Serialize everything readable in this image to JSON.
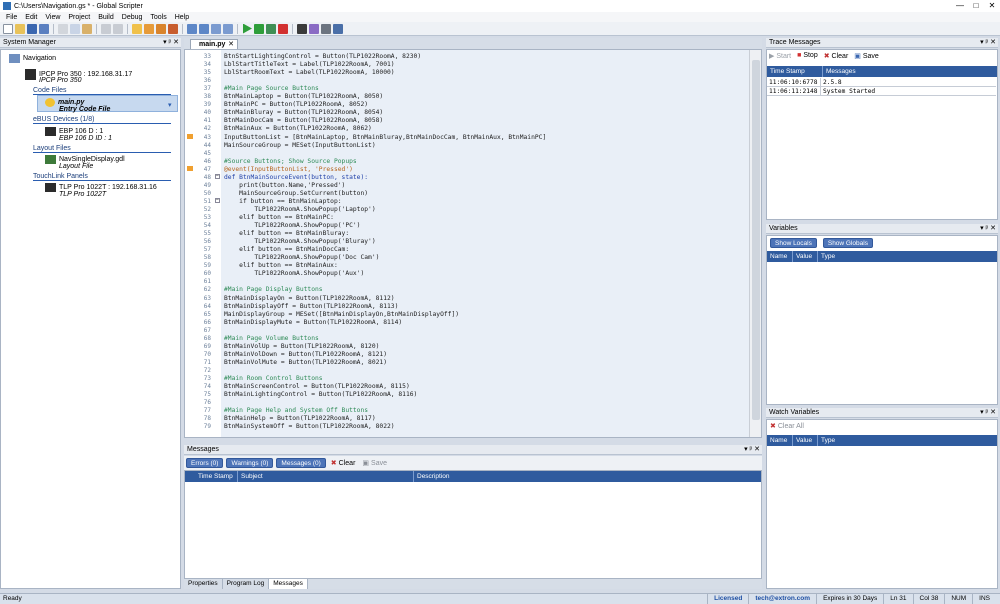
{
  "window": {
    "title": "C:\\Users\\Navigation.gs * - Global Scripter",
    "controls": [
      "—",
      "□",
      "✕"
    ]
  },
  "menu": [
    "File",
    "Edit",
    "View",
    "Project",
    "Build",
    "Debug",
    "Tools",
    "Help"
  ],
  "toolbar_icons": [
    "new-icon",
    "open-icon",
    "save-icon",
    "save-all-icon",
    "cut-icon",
    "copy-icon",
    "paste-icon",
    "undo-icon",
    "redo-icon",
    "add-file-icon",
    "add-device-icon",
    "add-panel-icon",
    "settings-icon",
    "indent-icon",
    "unindent-icon",
    "comment-icon",
    "uncomment-icon",
    "run-icon",
    "debug-icon",
    "step-icon",
    "stop-icon",
    "pilcrow-icon",
    "wand-icon",
    "pin-icon",
    "tool-icon"
  ],
  "system_manager": {
    "title": "System Manager",
    "root": "Navigation",
    "controller": {
      "name": "IPCP Pro 350 : 192.168.31.17",
      "sub": "IPCP Pro 350"
    },
    "code_files": {
      "header": "Code Files",
      "file": "main.py",
      "sub": "Entry Code File"
    },
    "ebus": {
      "header": "eBUS Devices (1/8)",
      "name": "EBP 106 D : 1",
      "sub": "EBP 106 D ID : 1"
    },
    "layout": {
      "header": "Layout Files",
      "name": "NavSingleDisplay.gdl",
      "sub": "Layout File"
    },
    "touchlink": {
      "header": "TouchLink Panels",
      "name": "TLP Pro 1022T : 192.168.31.16",
      "sub": "TLP Pro 1022T"
    }
  },
  "editor": {
    "tab": "main.py",
    "lines": [
      {
        "n": "33",
        "t": "BtnStartLightingControl = Button(TLP1022RoomA, 8230)"
      },
      {
        "n": "34",
        "t": "LblStartTitleText = Label(TLP1022RoomA, 7001)"
      },
      {
        "n": "35",
        "t": "LblStartRoomText = Label(TLP1022RoomA, 10000)"
      },
      {
        "n": "36",
        "t": ""
      },
      {
        "n": "37",
        "t": "#Main Page Source Buttons"
      },
      {
        "n": "38",
        "t": "BtnMainLaptop = Button(TLP1022RoomA, 8050)"
      },
      {
        "n": "39",
        "t": "BtnMainPC = Button(TLP1022RoomA, 8052)"
      },
      {
        "n": "40",
        "t": "BtnMainBluray = Button(TLP1022RoomA, 8054)"
      },
      {
        "n": "41",
        "t": "BtnMainDocCam = Button(TLP1022RoomA, 8058)"
      },
      {
        "n": "42",
        "t": "BtnMainAux = Button(TLP1022RoomA, 8062)"
      },
      {
        "n": "43",
        "t": "InputButtonList = [BtnMainLaptop, BtnMainBluray,BtnMainDocCam, BtnMainAux, BtnMainPC]"
      },
      {
        "n": "44",
        "t": "MainSourceGroup = MESet(InputButtonList)"
      },
      {
        "n": "45",
        "t": ""
      },
      {
        "n": "46",
        "t": "#Source Buttons; Show Source Popups"
      },
      {
        "n": "47",
        "t": "@event(InputButtonList, 'Pressed')"
      },
      {
        "n": "48",
        "t": "def BtnMainSourceEvent(button, state):"
      },
      {
        "n": "49",
        "t": "    print(button.Name,'Pressed')"
      },
      {
        "n": "50",
        "t": "    MainSourceGroup.SetCurrent(button)"
      },
      {
        "n": "51",
        "t": "    if button == BtnMainLaptop:"
      },
      {
        "n": "52",
        "t": "        TLP1022RoomA.ShowPopup('Laptop')"
      },
      {
        "n": "53",
        "t": "    elif button == BtnMainPC:"
      },
      {
        "n": "54",
        "t": "        TLP1022RoomA.ShowPopup('PC')"
      },
      {
        "n": "55",
        "t": "    elif button == BtnMainBluray:"
      },
      {
        "n": "56",
        "t": "        TLP1022RoomA.ShowPopup('Bluray')"
      },
      {
        "n": "57",
        "t": "    elif button == BtnMainDocCam:"
      },
      {
        "n": "58",
        "t": "        TLP1022RoomA.ShowPopup('Doc Cam')"
      },
      {
        "n": "59",
        "t": "    elif button == BtnMainAux:"
      },
      {
        "n": "60",
        "t": "        TLP1022RoomA.ShowPopup('Aux')"
      },
      {
        "n": "61",
        "t": ""
      },
      {
        "n": "62",
        "t": "#Main Page Display Buttons"
      },
      {
        "n": "63",
        "t": "BtnMainDisplayOn = Button(TLP1022RoomA, 8112)"
      },
      {
        "n": "64",
        "t": "BtnMainDisplayOff = Button(TLP1022RoomA, 8113)"
      },
      {
        "n": "65",
        "t": "MainDisplayGroup = MESet([BtnMainDisplayOn,BtnMainDisplayOff])"
      },
      {
        "n": "66",
        "t": "BtnMainDisplayMute = Button(TLP1022RoomA, 8114)"
      },
      {
        "n": "67",
        "t": ""
      },
      {
        "n": "68",
        "t": "#Main Page Volume Buttons"
      },
      {
        "n": "69",
        "t": "BtnMainVolUp = Button(TLP1022RoomA, 8120)"
      },
      {
        "n": "70",
        "t": "BtnMainVolDown = Button(TLP1022RoomA, 8121)"
      },
      {
        "n": "71",
        "t": "BtnMainVolMute = Button(TLP1022RoomA, 8021)"
      },
      {
        "n": "72",
        "t": ""
      },
      {
        "n": "73",
        "t": "#Main Room Control Buttons"
      },
      {
        "n": "74",
        "t": "BtnMainScreenControl = Button(TLP1022RoomA, 8115)"
      },
      {
        "n": "75",
        "t": "BtnMainLightingControl = Button(TLP1022RoomA, 8116)"
      },
      {
        "n": "76",
        "t": ""
      },
      {
        "n": "77",
        "t": "#Main Page Help and System Off Buttons"
      },
      {
        "n": "78",
        "t": "BtnMainHelp = Button(TLP1022RoomA, 8117)"
      },
      {
        "n": "79",
        "t": "BtnMainSystemOff = Button(TLP1022RoomA, 8022)"
      }
    ]
  },
  "messages": {
    "title": "Messages",
    "errors": "Errors (0)",
    "warnings": "Warnings (0)",
    "messages_btn": "Messages (0)",
    "clear": "Clear",
    "save": "Save",
    "columns": [
      "Time Stamp",
      "Subject",
      "Description"
    ]
  },
  "bottom_tabs": [
    "Properties",
    "Program Log",
    "Messages"
  ],
  "trace": {
    "title": "Trace Messages",
    "start": "Start",
    "stop": "Stop",
    "clear": "Clear",
    "save": "Save",
    "columns": [
      "Time Stamp",
      "Messages"
    ],
    "rows": [
      {
        "time": "11:06:10:6778",
        "msg": "2.5.8"
      },
      {
        "time": "11:06:11:2148",
        "msg": "System Started"
      }
    ]
  },
  "variables": {
    "title": "Variables",
    "show_locals": "Show Locals",
    "show_globals": "Show Globals",
    "columns": [
      "Name",
      "Value",
      "Type"
    ]
  },
  "watch": {
    "title": "Watch Variables",
    "clear_all": "Clear All",
    "columns": [
      "Name",
      "Value",
      "Type"
    ]
  },
  "status": {
    "ready": "Ready",
    "licensed": "Licensed",
    "email": "tech@extron.com",
    "expires": "Expires in 30 Days",
    "ln": "Ln 31",
    "col": "Col 38",
    "num": "NUM",
    "ins": "INS"
  },
  "colors": {
    "accent": "#2f5b9e",
    "code_bg": "#e9eff7",
    "marker": "#f0a030"
  }
}
